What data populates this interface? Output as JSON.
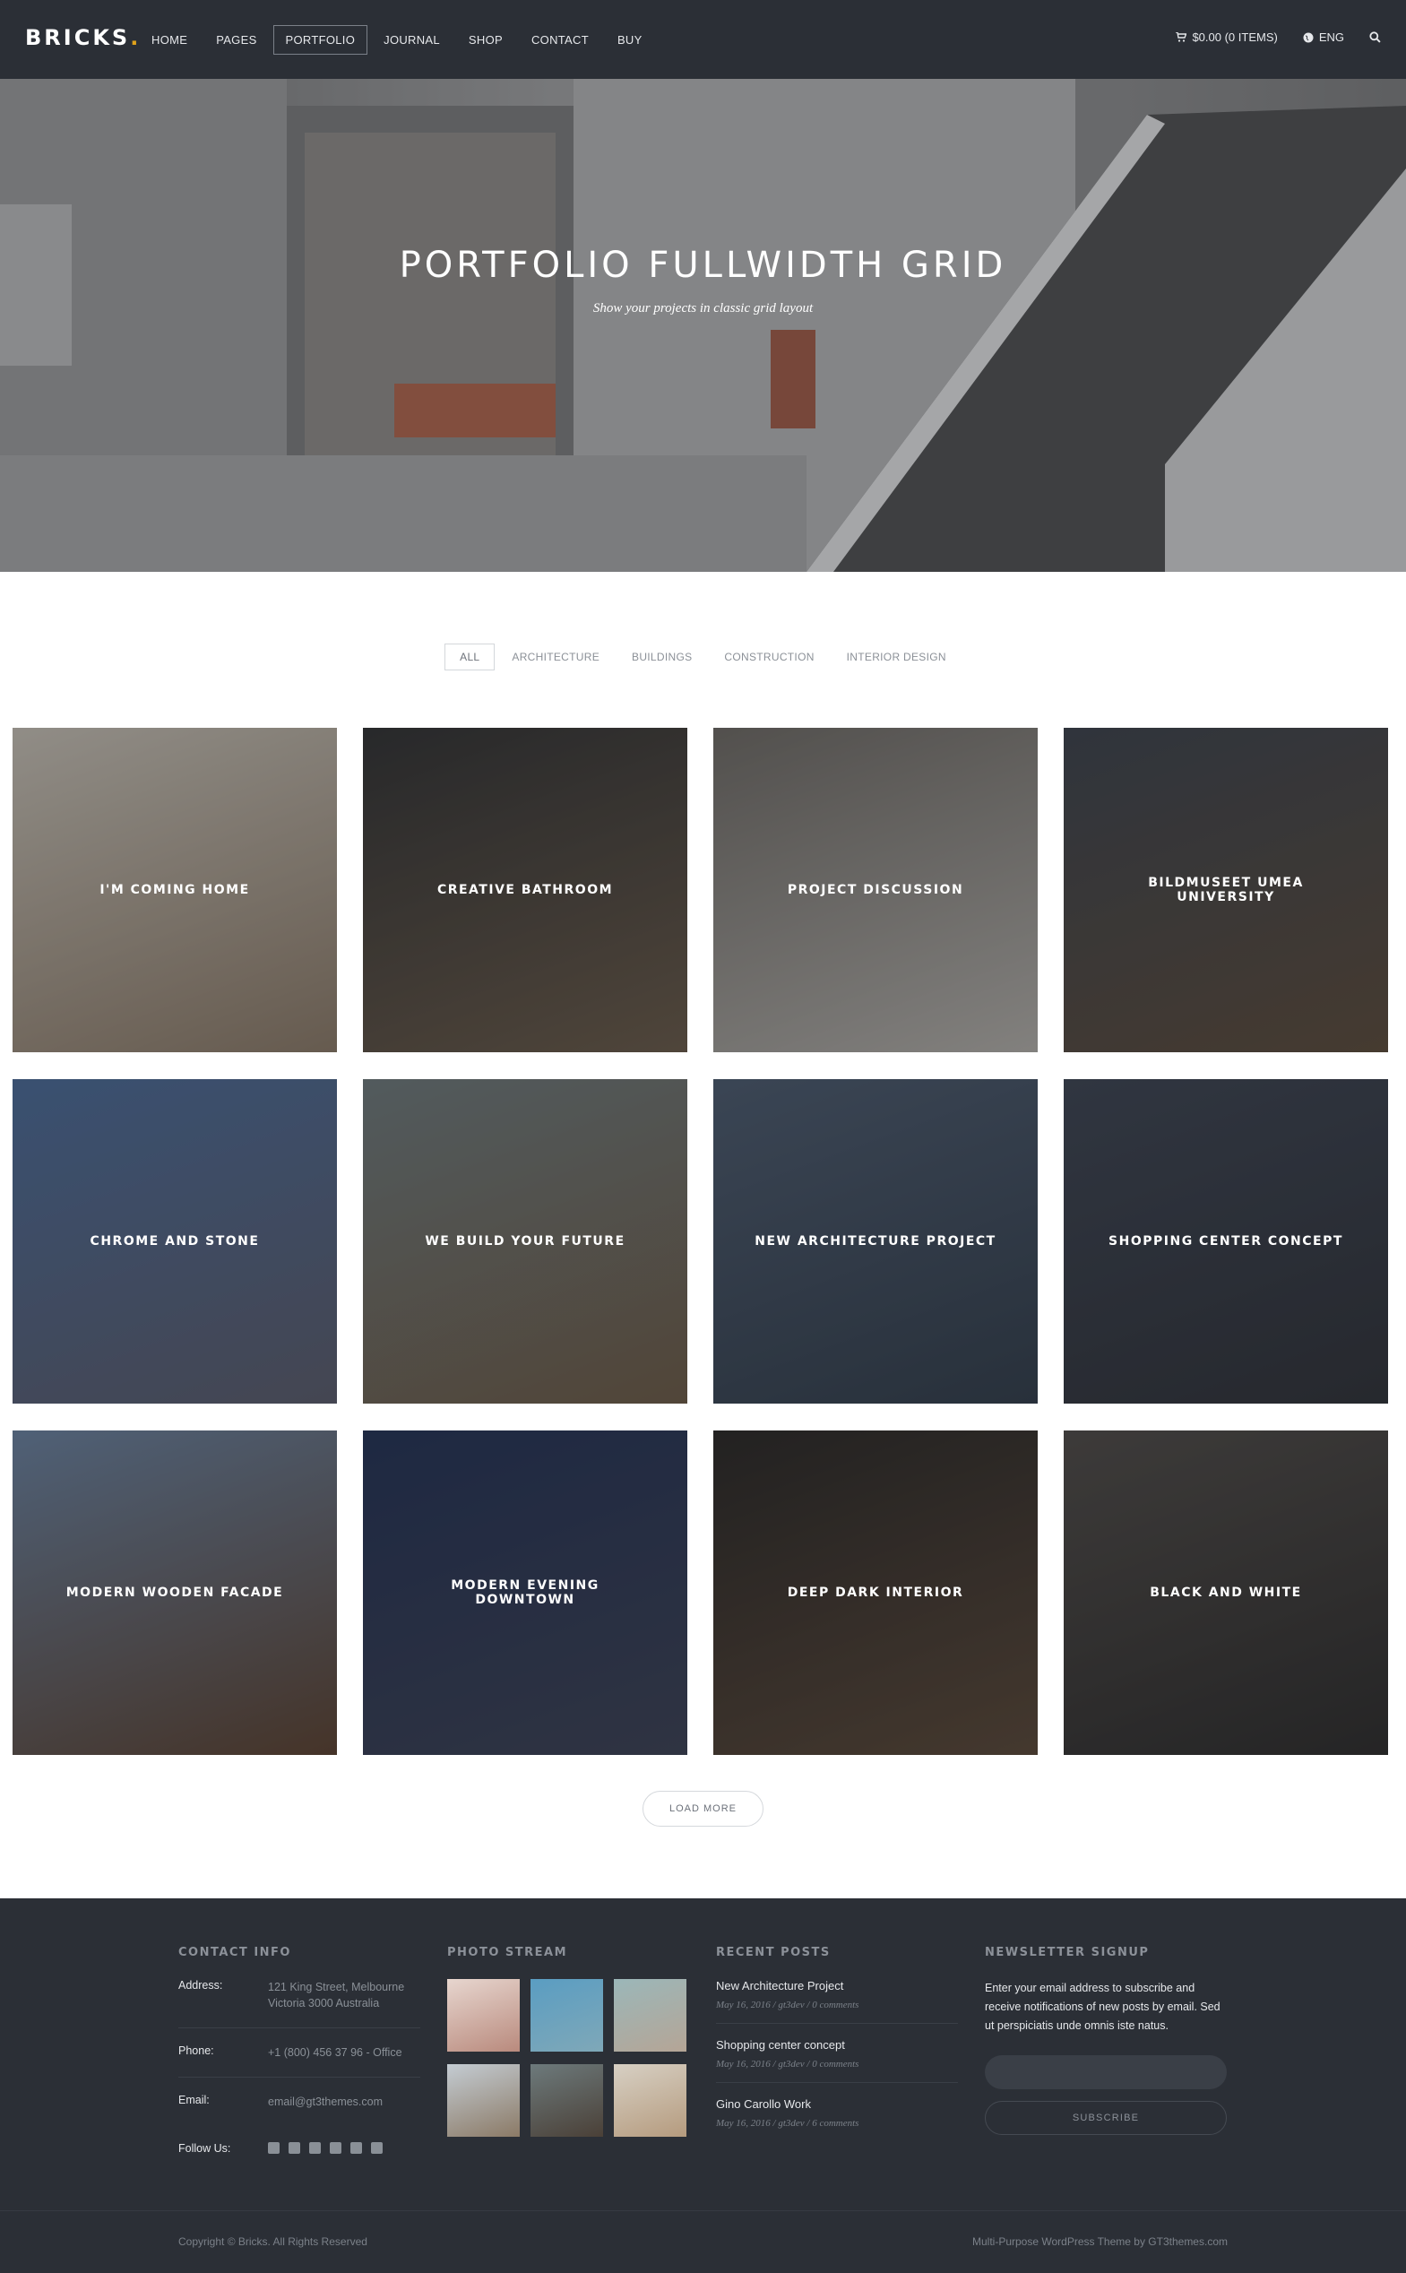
{
  "header": {
    "logo_text": "BRICKS",
    "logo_dot": ".",
    "nav": [
      {
        "label": "HOME"
      },
      {
        "label": "PAGES"
      },
      {
        "label": "PORTFOLIO",
        "active": true
      },
      {
        "label": "JOURNAL"
      },
      {
        "label": "SHOP"
      },
      {
        "label": "CONTACT"
      },
      {
        "label": "BUY"
      }
    ],
    "cart_text": "$0.00 (0 ITEMS)",
    "language": "ENG"
  },
  "hero": {
    "title": "PORTFOLIO FULLWIDTH GRID",
    "subtitle": "Show your projects in classic grid layout"
  },
  "filters": [
    {
      "label": "ALL",
      "active": true
    },
    {
      "label": "ARCHITECTURE"
    },
    {
      "label": "BUILDINGS"
    },
    {
      "label": "CONSTRUCTION"
    },
    {
      "label": "INTERIOR DESIGN"
    }
  ],
  "portfolio": [
    {
      "title": "I'M COMING HOME",
      "colors": [
        "#cfc8bb",
        "#8e7b66"
      ]
    },
    {
      "title": "CREATIVE BATHROOM",
      "colors": [
        "#2e2e2e",
        "#6b5a46"
      ]
    },
    {
      "title": "PROJECT DISCUSSION",
      "colors": [
        "#6f6a63",
        "#b9b5ae"
      ]
    },
    {
      "title": "BILDMUSEET UMEA UNIVERSITY",
      "colors": [
        "#3a4049",
        "#5c4a37"
      ]
    },
    {
      "title": "CHROME AND STONE",
      "colors": [
        "#4a6b9a",
        "#5a5b6a"
      ]
    },
    {
      "title": "WE BUILD YOUR FUTURE",
      "colors": [
        "#6f7b7c",
        "#6e5a43"
      ]
    },
    {
      "title": "NEW ARCHITECTURE PROJECT",
      "colors": [
        "#4b5a6e",
        "#2f3a47"
      ]
    },
    {
      "title": "SHOPPING CENTER CONCEPT",
      "colors": [
        "#3b4250",
        "#2c2e33"
      ]
    },
    {
      "title": "MODERN WOODEN FACADE",
      "colors": [
        "#6b84a3",
        "#5b3f2b"
      ]
    },
    {
      "title": "MODERN EVENING DOWNTOWN",
      "colors": [
        "#1f2e52",
        "#3a3f52"
      ]
    },
    {
      "title": "DEEP DARK INTERIOR",
      "colors": [
        "#262320",
        "#5a4634"
      ]
    },
    {
      "title": "BLACK AND WHITE",
      "colors": [
        "#4f4a45",
        "#2a2826"
      ]
    }
  ],
  "load_more_label": "LOAD MORE",
  "footer": {
    "contact": {
      "heading": "CONTACT INFO",
      "rows": [
        {
          "key": "Address:",
          "value": "121 King Street, Melbourne Victoria 3000 Australia"
        },
        {
          "key": "Phone:",
          "value": "+1 (800) 456 37 96 - Office"
        },
        {
          "key": "Email:",
          "value": "email@gt3themes.com"
        }
      ],
      "follow_label": "Follow Us:",
      "social_icons": [
        "facebook-icon",
        "pinterest-icon",
        "twitter-icon",
        "dribbble-icon",
        "instagram-icon",
        "flickr-icon"
      ]
    },
    "photo_stream": {
      "heading": "PHOTO STREAM",
      "photos": [
        {
          "colors": [
            "#e7d6cf",
            "#b98a7d"
          ]
        },
        {
          "colors": [
            "#5a9dc2",
            "#7fa8b8"
          ]
        },
        {
          "colors": [
            "#9bb7b9",
            "#b5a596"
          ]
        },
        {
          "colors": [
            "#c4ccd3",
            "#8b7a66"
          ]
        },
        {
          "colors": [
            "#6d7a7c",
            "#4a4037"
          ]
        },
        {
          "colors": [
            "#d7d0c4",
            "#b59b7e"
          ]
        }
      ]
    },
    "recent_posts": {
      "heading": "RECENT POSTS",
      "posts": [
        {
          "title": "New Architecture Project",
          "meta": "May 16, 2016  /  gt3dev  /  0 comments"
        },
        {
          "title": "Shopping center concept",
          "meta": "May 16, 2016  /  gt3dev  /  0 comments"
        },
        {
          "title": "Gino Carollo Work",
          "meta": "May 16, 2016  /  gt3dev  /  6 comments"
        }
      ]
    },
    "newsletter": {
      "heading": "NEWSLETTER SIGNUP",
      "text": "Enter your email address to subscribe and receive notifications of new posts by email. Sed ut perspiciatis unde omnis iste natus.",
      "input_value": "",
      "button_label": "SUBSCRIBE"
    },
    "copyright": "Copyright © Bricks. All Rights Reserved",
    "credit": "Multi-Purpose WordPress Theme by GT3themes.com"
  }
}
